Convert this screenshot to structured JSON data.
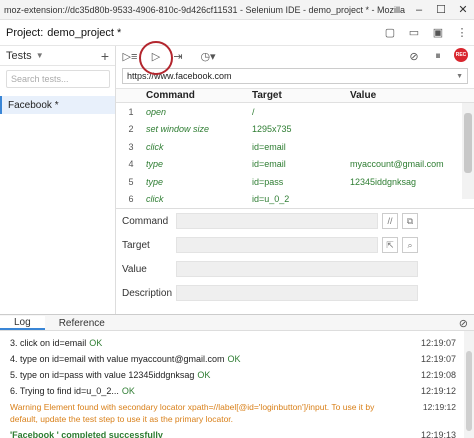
{
  "window": {
    "title": "moz-extension://dc35d80b-9533-4906-810c-9d426cf11531 - Selenium IDE - demo_project * - Mozilla Firefox"
  },
  "project": {
    "label": "Project:",
    "name": "demo_project *"
  },
  "sidebar": {
    "header": "Tests",
    "search_placeholder": "Search tests...",
    "items": [
      {
        "label": "Facebook *"
      }
    ]
  },
  "url": {
    "value": "https://www.facebook.com"
  },
  "rec_label": "REC",
  "table": {
    "headers": [
      "Command",
      "Target",
      "Value"
    ],
    "rows": [
      {
        "n": "1",
        "command": "open",
        "target": "/",
        "value": ""
      },
      {
        "n": "2",
        "command": "set window size",
        "target": "1295x735",
        "value": ""
      },
      {
        "n": "3",
        "command": "click",
        "target": "id=email",
        "value": ""
      },
      {
        "n": "4",
        "command": "type",
        "target": "id=email",
        "value": "myaccount@gmail.com"
      },
      {
        "n": "5",
        "command": "type",
        "target": "id=pass",
        "value": "12345iddgnksag"
      },
      {
        "n": "6",
        "command": "click",
        "target": "id=u_0_2",
        "value": ""
      }
    ]
  },
  "editor": {
    "command": "Command",
    "target": "Target",
    "value": "Value",
    "description": "Description"
  },
  "log": {
    "tabs": [
      "Log",
      "Reference"
    ],
    "lines": [
      {
        "text": "3.  click on id=email",
        "status": "OK",
        "time": "12:19:07"
      },
      {
        "text": "4.  type on id=email with value myaccount@gmail.com",
        "status": "OK",
        "time": "12:19:07"
      },
      {
        "text": "5.  type on id=pass with value 12345iddgnksag",
        "status": "OK",
        "time": "12:19:08"
      },
      {
        "text": "6.  Trying to find id=u_0_2...",
        "status": "OK",
        "time": "12:19:12"
      }
    ],
    "warning": {
      "text": "Warning Element found with secondary locator xpath=//label[@id='loginbutton']/input. To use it by default, update the test step to use it as the primary locator.",
      "time": "12:19:12"
    },
    "success": {
      "text": "'Facebook ' completed successfully",
      "time": "12:19:13"
    }
  },
  "colors": {
    "accent": "#3a86d6",
    "ok": "#2e7d32",
    "warning": "#d9801a",
    "highlight": "#b3262e"
  }
}
